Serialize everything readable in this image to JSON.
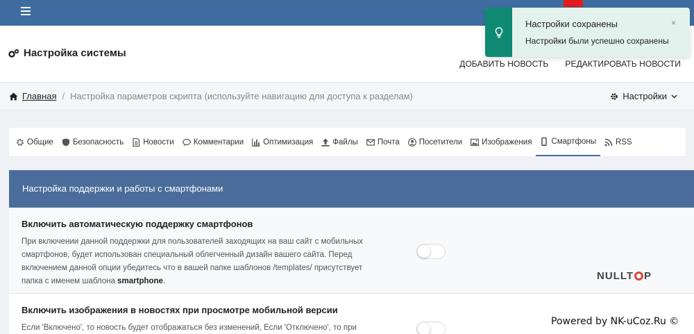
{
  "header": {
    "title": "Настройка системы",
    "links": [
      "ДОБАВИТЬ НОВОСТЬ",
      "РЕДАКТИРОВАТЬ НОВОСТИ"
    ]
  },
  "breadcrumb": {
    "home": "Главная",
    "separator": "/",
    "current": "Настройка параметров скрипта (используйте навигацию для доступа к разделам)"
  },
  "settings_menu": {
    "label": "Настройки"
  },
  "tabs": [
    {
      "label": "Общие",
      "icon": "gear-icon"
    },
    {
      "label": "Безопасность",
      "icon": "shield-icon"
    },
    {
      "label": "Новости",
      "icon": "document-icon"
    },
    {
      "label": "Комментарии",
      "icon": "comments-icon"
    },
    {
      "label": "Оптимизация",
      "icon": "bar-chart-icon"
    },
    {
      "label": "Файлы",
      "icon": "upload-icon"
    },
    {
      "label": "Почта",
      "icon": "envelope-icon"
    },
    {
      "label": "Посетители",
      "icon": "user-icon"
    },
    {
      "label": "Изображения",
      "icon": "image-icon"
    },
    {
      "label": "Смартфоны",
      "icon": "mobile-icon",
      "active": true
    },
    {
      "label": "RSS",
      "icon": "rss-icon"
    }
  ],
  "panel": {
    "title": "Настройка поддержки и работы с смартфонами",
    "settings": [
      {
        "title": "Включить автоматическую поддержку смартфонов",
        "description": "При включении данной поддержки для пользователей заходящих на ваш сайт с мобильных смартфонов, будет использован специальный облегченный дизайн вашего сайта. Перед включением данной опции убедитесь что в вашей папке шаблонов /templates/ присутствует папка с именем шаблона ",
        "description_bold": "smartphone",
        "description_end": ".",
        "enabled": false
      },
      {
        "title": "Включить изображения в новостях при просмотре мобильной версии",
        "description": "Если 'Включено', то новость будет отображаться без изменений, Если 'Отключено', то при",
        "enabled": false
      }
    ]
  },
  "toast": {
    "title": "Настройки сохранены",
    "message": "Настройки были успешно сохранены",
    "close": "×",
    "icon": "lightbulb-icon",
    "accent_color": "#0e8a73"
  },
  "watermark": {
    "text_left": "NULLT",
    "text_right": "P"
  },
  "footer": {
    "powered": "Powered by NK-uCoz.Ru ©"
  },
  "colors": {
    "topbar": "#3f6da1",
    "panel_header": "#4b6d9b"
  }
}
